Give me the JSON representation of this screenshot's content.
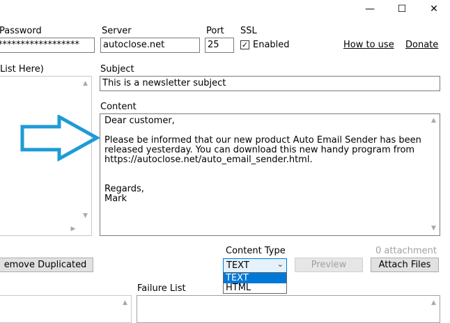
{
  "window": {
    "minimize_icon": "—",
    "maximize_icon": "☐",
    "close_icon": "✕"
  },
  "smtp": {
    "password_label": "Password",
    "password_value": "********************",
    "server_label": "Server",
    "server_value": "autoclose.net",
    "port_label": "Port",
    "port_value": "25",
    "ssl_label": "SSL",
    "ssl_checkbox_label": "Enabled",
    "ssl_checked": "✓"
  },
  "links": {
    "how_to_use": "How to use",
    "donate": "Donate"
  },
  "recipients": {
    "label": "List Here)"
  },
  "subject": {
    "label": "Subject",
    "value": "This is a newsletter subject"
  },
  "content": {
    "label": "Content",
    "text": "Dear customer,\n\nPlease be informed that our new product Auto Email Sender has been released yesterday. You can download this new handy program from https://autoclose.net/auto_email_sender.html.\n\n\nRegards,\nMark"
  },
  "content_type": {
    "label": "Content Type",
    "selected": "TEXT",
    "options": [
      "TEXT",
      "HTML"
    ]
  },
  "attachments": {
    "count_label": "0 attachment"
  },
  "buttons": {
    "remove_duplicated": "emove Duplicated",
    "preview": "Preview",
    "attach_files": "Attach Files"
  },
  "failure": {
    "label": "Failure List"
  },
  "colors": {
    "arrow": "#1e9bd7",
    "selection": "#0078d7",
    "dropdown_bg": "#e5f1fb"
  }
}
